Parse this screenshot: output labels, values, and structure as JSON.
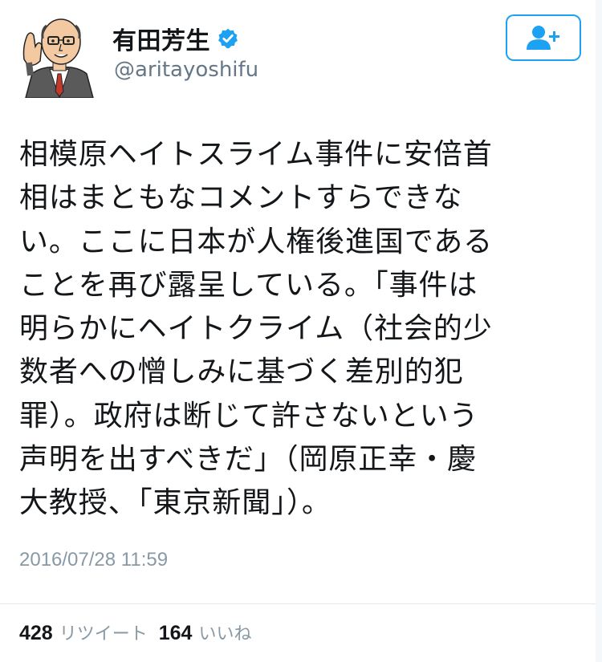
{
  "user": {
    "display_name": "有田芳生",
    "handle": "@aritayoshifu",
    "verified": true,
    "avatar_icon": "caricature-avatar-icon",
    "follow_icon": "add-user-icon"
  },
  "tweet": {
    "text_lines": [
      "相模原ヘイトスライム事件に安倍首",
      "相はまともなコメントすらできな",
      "い。ここに日本が人権後進国である",
      "ことを再び露呈している。「事件は",
      "明らかにヘイトクライム（社会的少",
      "数者への憎しみに基づく差別的犯",
      "罪）。政府は断じて許さないという",
      "声明を出すべきだ」（岡原正幸・慶",
      "大教授、「東京新聞」）。"
    ],
    "timestamp": "2016/07/28 11:59"
  },
  "stats": {
    "retweets_count": "428",
    "retweets_label": "リツイート",
    "likes_count": "164",
    "likes_label": "いいね"
  },
  "colors": {
    "accent": "#1da1f2",
    "text": "#14171a",
    "muted": "#657786",
    "timestamp": "#8899a6"
  }
}
